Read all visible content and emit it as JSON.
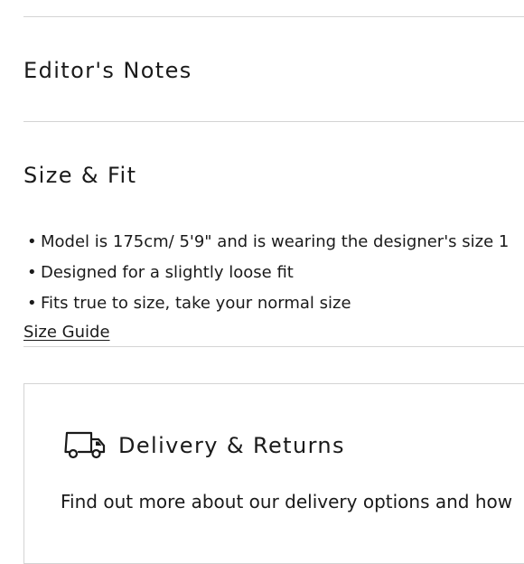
{
  "editors_notes": {
    "title": "Editor's Notes"
  },
  "size_fit": {
    "title": "Size & Fit",
    "items": [
      "Model is 175cm/ 5'9\" and is wearing the designer's size 1",
      "Designed for a slightly loose fit",
      "Fits true to size, take your normal size"
    ],
    "size_guide_link": "Size Guide"
  },
  "delivery": {
    "icon": "truck-icon",
    "title": "Delivery & Returns",
    "text": "Find out more about our delivery options and how"
  }
}
